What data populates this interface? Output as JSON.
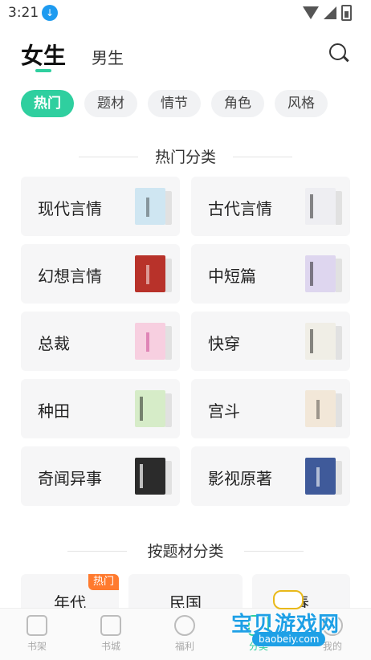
{
  "status_bar": {
    "time": "3:21"
  },
  "header": {
    "tabs": [
      "女生",
      "男生"
    ]
  },
  "chips": [
    "热门",
    "题材",
    "情节",
    "角色",
    "风格"
  ],
  "sections": {
    "hot": "热门分类",
    "by_theme": "按题材分类"
  },
  "categories": [
    {
      "name": "现代言情",
      "cover_color": "#cfe6f2"
    },
    {
      "name": "古代言情",
      "cover_color": "#eeeef2"
    },
    {
      "name": "幻想言情",
      "cover_color": "#b8322a"
    },
    {
      "name": "中短篇",
      "cover_color": "#ded6ef"
    },
    {
      "name": "总裁",
      "cover_color": "#f7cfe0"
    },
    {
      "name": "快穿",
      "cover_color": "#f0eee6"
    },
    {
      "name": "种田",
      "cover_color": "#d6ecc8"
    },
    {
      "name": "宫斗",
      "cover_color": "#f2e7d8"
    },
    {
      "name": "奇闻异事",
      "cover_color": "#2b2b2b"
    },
    {
      "name": "影视原著",
      "cover_color": "#3f5a9a"
    }
  ],
  "theme_categories": [
    {
      "name": "年代",
      "badge": "热门"
    },
    {
      "name": "民国",
      "badge": ""
    },
    {
      "name": "春",
      "badge": ""
    }
  ],
  "bottom_nav": [
    "书架",
    "书城",
    "福利",
    "分类",
    "我的"
  ],
  "watermark": {
    "text": "宝贝游戏网",
    "url": "baobeiy.com"
  },
  "accent_color": "#2fcf9f"
}
